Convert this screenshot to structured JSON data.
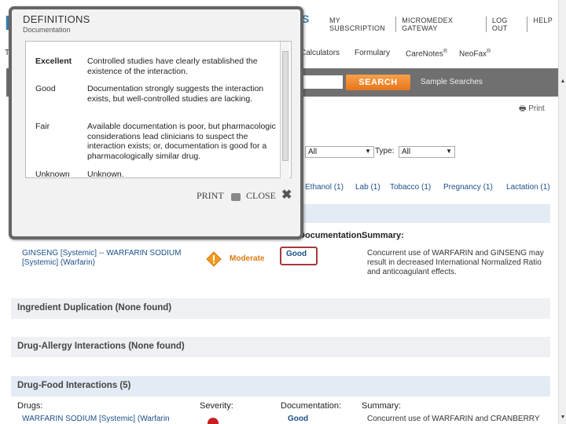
{
  "header": {
    "logo_letter": "M",
    "brand_fragment": "S",
    "links": [
      "MY SUBSCRIPTION",
      "MICROMEDEX GATEWAY",
      "LOG OUT",
      "HELP"
    ]
  },
  "tabs": {
    "fragment": "T",
    "items": [
      {
        "label": "Calculators"
      },
      {
        "label": "Formulary"
      },
      {
        "label": "CareNotes",
        "sup": "®"
      },
      {
        "label": "NeoFax",
        "sup": "®"
      }
    ]
  },
  "search": {
    "button_label": "SEARCH",
    "sample_link": "Sample Searches"
  },
  "print_top": "Print",
  "filters": {
    "severity_value": "All",
    "type_label": "Type:",
    "type_value": "All"
  },
  "category_counts": [
    "Ethanol (1)",
    "Lab (1)",
    "Tobacco (1)",
    "Pregnancy (1)",
    "Lactation (1)"
  ],
  "table": {
    "col_documentation": "Documentation:",
    "col_summary": "Summary:",
    "row": {
      "drugs_line1": "GINSENG [Systemic] -- WARFARIN SODIUM",
      "drugs_line2": "[Systemic] (Warfarin)",
      "severity": "Moderate",
      "documentation": "Good",
      "summary": "Concurrent use of WARFARIN and GINSENG may result in decreased International Normalized Ratio and anticoagulant effects."
    }
  },
  "sections": {
    "ingredient_dup": "Ingredient Duplication (None found)",
    "drug_allergy": "Drug-Allergy Interactions (None found)",
    "drug_food": "Drug-Food Interactions (5)"
  },
  "food_header": {
    "drugs": "Drugs:",
    "severity": "Severity:",
    "documentation": "Documentation:",
    "summary": "Summary:"
  },
  "bottom_row": {
    "drug": "WARFARIN SODIUM [Systemic] (Warfarin",
    "doc": "Good",
    "summary": "Concurrent use of WARFARIN and CRANBERRY"
  },
  "modal": {
    "title": "DEFINITIONS",
    "subtitle": "Documentation",
    "definitions": [
      {
        "term": "Excellent",
        "desc": "Controlled studies have clearly established the existence of the interaction."
      },
      {
        "term": "Good",
        "desc": "Documentation strongly suggests the interaction exists, but well-controlled studies are lacking."
      },
      {
        "term": "Fair",
        "desc": "Available documentation is poor, but pharmacologic considerations lead clinicians to suspect the interaction exists; or, documentation is good for a pharmacologically similar drug."
      },
      {
        "term": "Unknown",
        "desc": "Unknown."
      }
    ],
    "print_label": "PRINT",
    "close_label": "CLOSE"
  }
}
